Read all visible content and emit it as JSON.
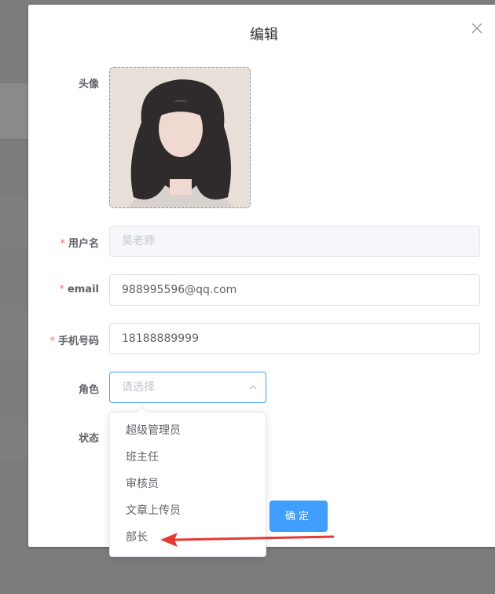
{
  "dialog": {
    "title": "编辑"
  },
  "form": {
    "avatar_label": "头像",
    "username_label": "用户名",
    "username_value": "吴老师",
    "email_label": "email",
    "email_value": "988995596@qq.com",
    "phone_label": "手机号码",
    "phone_value": "18188889999",
    "role_label": "角色",
    "role_placeholder": "请选择",
    "status_label": "状态",
    "required_mark": "*"
  },
  "role_options": [
    "超级管理员",
    "班主任",
    "审核员",
    "文章上传员",
    "部长"
  ],
  "buttons": {
    "confirm_label": "确定"
  },
  "colors": {
    "primary": "#409eff",
    "required": "#f56c6c",
    "annotation_arrow": "#e53935"
  },
  "icons": {
    "close": "close-icon",
    "select_arrow": "chevron-up-icon"
  }
}
